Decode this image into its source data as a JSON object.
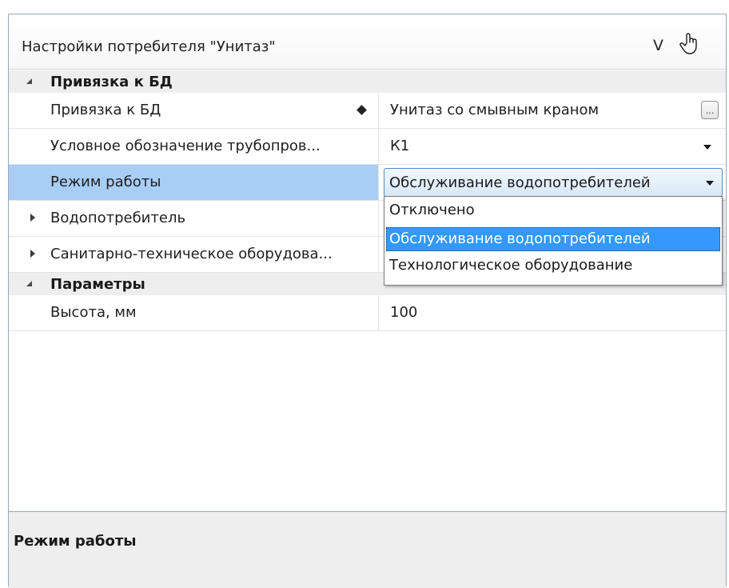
{
  "header": {
    "title": "Настройки потребителя \"Унитаз\"",
    "v_label": "V",
    "hand_icon": "hand-pointer-icon"
  },
  "categories": {
    "db_binding": "Привязка к БД",
    "params": "Параметры"
  },
  "rows": {
    "db_binding": {
      "name": "Привязка к БД",
      "value": "Унитаз со смывным краном",
      "button": "..."
    },
    "pipe_symbol": {
      "name": "Условное обозначение трубопров...",
      "value": "К1"
    },
    "mode": {
      "name": "Режим работы",
      "value": "Обслуживание водопотребителей"
    },
    "consumer": {
      "name": "Водопотребитель"
    },
    "sanitary": {
      "name": "Санитарно-техническое оборудова..."
    },
    "height": {
      "name": "Высота, мм",
      "value": "100"
    }
  },
  "dropdown": {
    "options": [
      "Отключено",
      "Обслуживание водопотребителей",
      "Технологическое оборудование"
    ],
    "selected_index": 1
  },
  "description": {
    "title": "Режим работы"
  },
  "colors": {
    "selection": "#3399ff",
    "row_highlight": "#a8cef6",
    "combo_border": "#4f8cc9"
  }
}
